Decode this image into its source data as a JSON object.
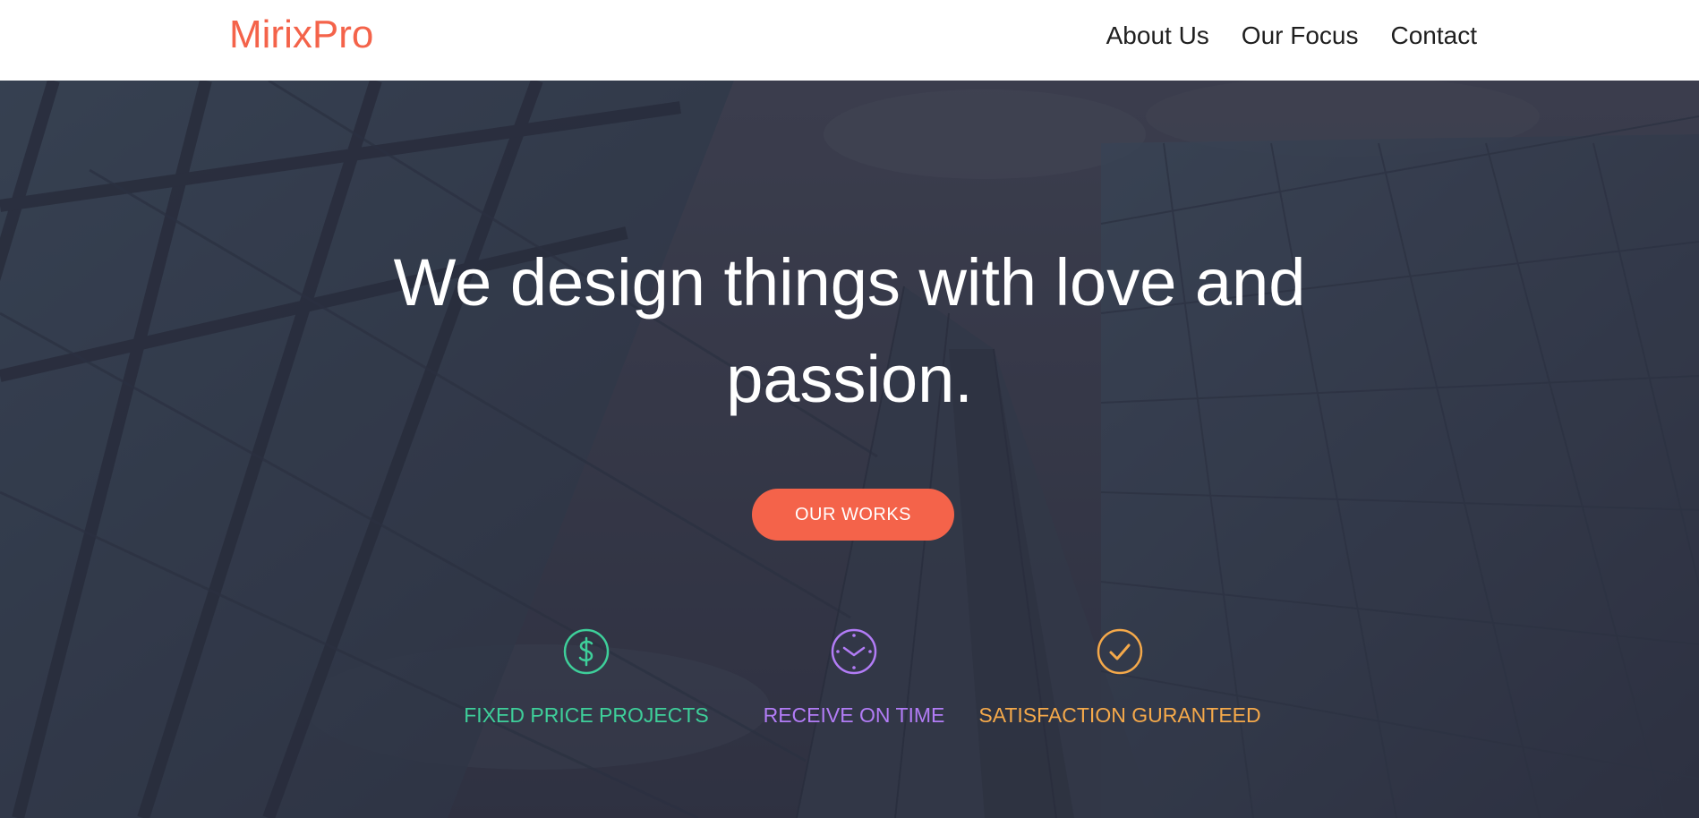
{
  "brand": {
    "name": "MirixPro",
    "color": "#f4634a"
  },
  "nav": {
    "links": [
      {
        "label": "About Us"
      },
      {
        "label": "Our Focus"
      },
      {
        "label": "Contact"
      }
    ]
  },
  "hero": {
    "headline": "We design things with love and passion.",
    "cta_label": "OUR WORKS",
    "cta_color": "#f4634a"
  },
  "features": [
    {
      "label": "FIXED PRICE PROJECTS",
      "icon": "dollar-circle-icon",
      "color": "#3ecf9a"
    },
    {
      "label": "RECEIVE ON TIME",
      "icon": "clock-icon",
      "color": "#b27cf6"
    },
    {
      "label": "SATISFACTION GURANTEED",
      "icon": "check-circle-icon",
      "color": "#f5a94a"
    }
  ]
}
